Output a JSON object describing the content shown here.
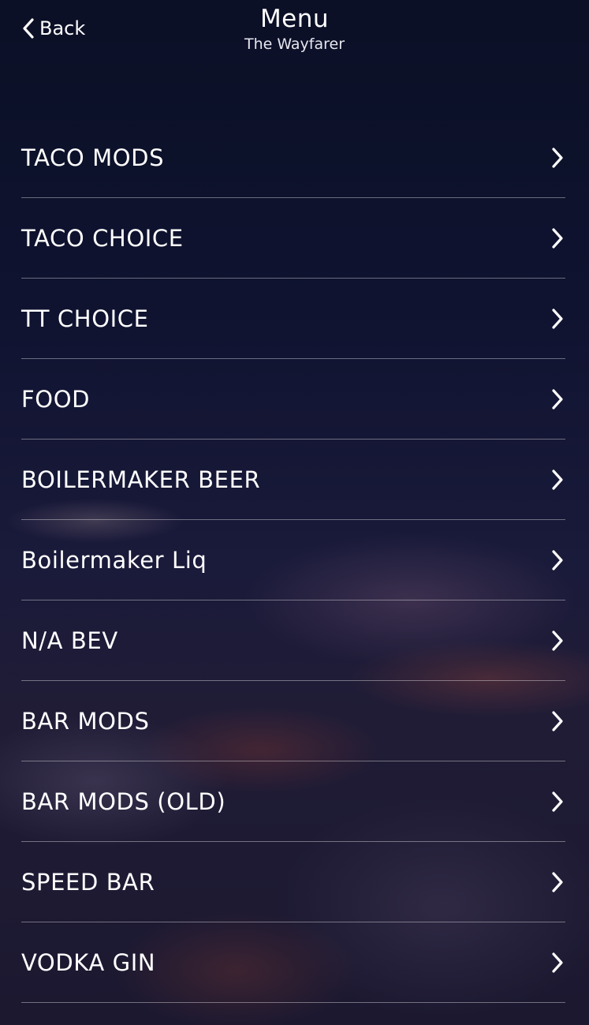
{
  "header": {
    "back_label": "Back",
    "title": "Menu",
    "subtitle": "The Wayfarer"
  },
  "menu": {
    "items": [
      {
        "label": "TACO MODS",
        "icon": "chevron-right-icon"
      },
      {
        "label": "TACO CHOICE",
        "icon": "chevron-right-icon"
      },
      {
        "label": "TT CHOICE",
        "icon": "chevron-right-icon"
      },
      {
        "label": "FOOD",
        "icon": "chevron-right-icon"
      },
      {
        "label": "BOILERMAKER BEER",
        "icon": "chevron-right-icon"
      },
      {
        "label": "Boilermaker Liq",
        "icon": "chevron-right-icon"
      },
      {
        "label": "N/A BEV",
        "icon": "chevron-right-icon"
      },
      {
        "label": "BAR MODS",
        "icon": "chevron-right-icon"
      },
      {
        "label": "BAR MODS (OLD)",
        "icon": "chevron-right-icon"
      },
      {
        "label": "SPEED BAR",
        "icon": "chevron-right-icon"
      },
      {
        "label": "VODKA GIN",
        "icon": "chevron-right-icon"
      }
    ]
  },
  "colors": {
    "text": "#ffffff",
    "background_top": "#0b1026",
    "divider": "#8a8aa0"
  }
}
